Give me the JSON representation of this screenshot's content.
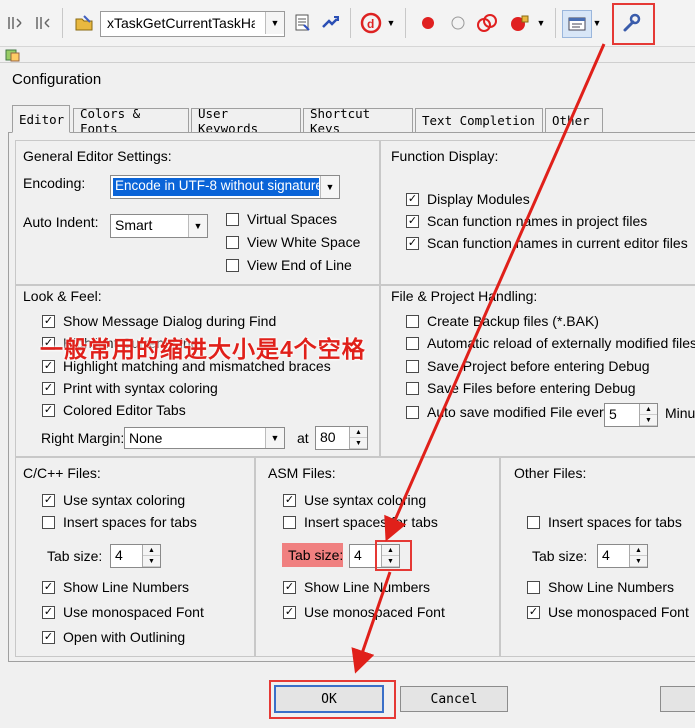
{
  "toolbar": {
    "function_combo": "xTaskGetCurrentTaskHan"
  },
  "dialog": {
    "title": "Configuration",
    "tabs": [
      "Editor",
      "Colors & Fonts",
      "User Keywords",
      "Shortcut Keys",
      "Text Completion",
      "Other"
    ],
    "active_tab": "Editor",
    "general": {
      "title": "General Editor Settings:",
      "encoding_label": "Encoding:",
      "encoding_value": "Encode in UTF-8 without signature",
      "auto_indent_label": "Auto Indent:",
      "auto_indent_value": "Smart",
      "virtual_spaces": "Virtual Spaces",
      "view_white_space": "View White Space",
      "view_end_of_line": "View End of Line"
    },
    "function_display": {
      "title": "Function Display:",
      "display_modules": "Display Modules",
      "scan_project": "Scan function names in project files",
      "scan_editor": "Scan function names in current editor files"
    },
    "look_feel": {
      "title": "Look & Feel:",
      "show_message": "Show Message Dialog during Find",
      "highlight_current": "Highlight Current Line",
      "highlight_braces": "Highlight matching and mismatched braces",
      "print_syntax": "Print with syntax coloring",
      "colored_tabs": "Colored Editor Tabs",
      "right_margin_label": "Right Margin:",
      "right_margin_value": "None",
      "at_label": "at",
      "at_value": "80"
    },
    "file_project": {
      "title": "File & Project Handling:",
      "create_backup": "Create Backup files (*.BAK)",
      "auto_reload": "Automatic reload of externally modified files",
      "save_project": "Save Project before entering Debug",
      "save_files": "Save Files before entering Debug",
      "auto_save": "Auto save modified File every",
      "auto_save_value": "5",
      "minutes": "Minutes"
    },
    "c_files": {
      "title": "C/C++ Files:",
      "syntax": "Use syntax coloring",
      "insert_spaces": "Insert spaces for tabs",
      "tab_size_label": "Tab size:",
      "tab_size": "4",
      "line_numbers": "Show Line Numbers",
      "monospaced": "Use monospaced Font",
      "outlining": "Open with Outlining"
    },
    "asm_files": {
      "title": "ASM Files:",
      "syntax": "Use syntax coloring",
      "insert_spaces": "Insert spaces for tabs",
      "tab_size_label": "Tab size:",
      "tab_size": "4",
      "line_numbers": "Show Line Numbers",
      "monospaced": "Use monospaced Font"
    },
    "other_files": {
      "title": "Other Files:",
      "insert_spaces": "Insert spaces for tabs",
      "tab_size_label": "Tab size:",
      "tab_size": "4",
      "line_numbers": "Show Line Numbers",
      "monospaced": "Use monospaced Font"
    },
    "buttons": {
      "ok": "OK",
      "cancel": "Cancel"
    }
  },
  "annotation": "一般常用的缩进大小是4个空格",
  "colors": {
    "annotation": "#e0201a",
    "selection": "#0a64d8"
  }
}
